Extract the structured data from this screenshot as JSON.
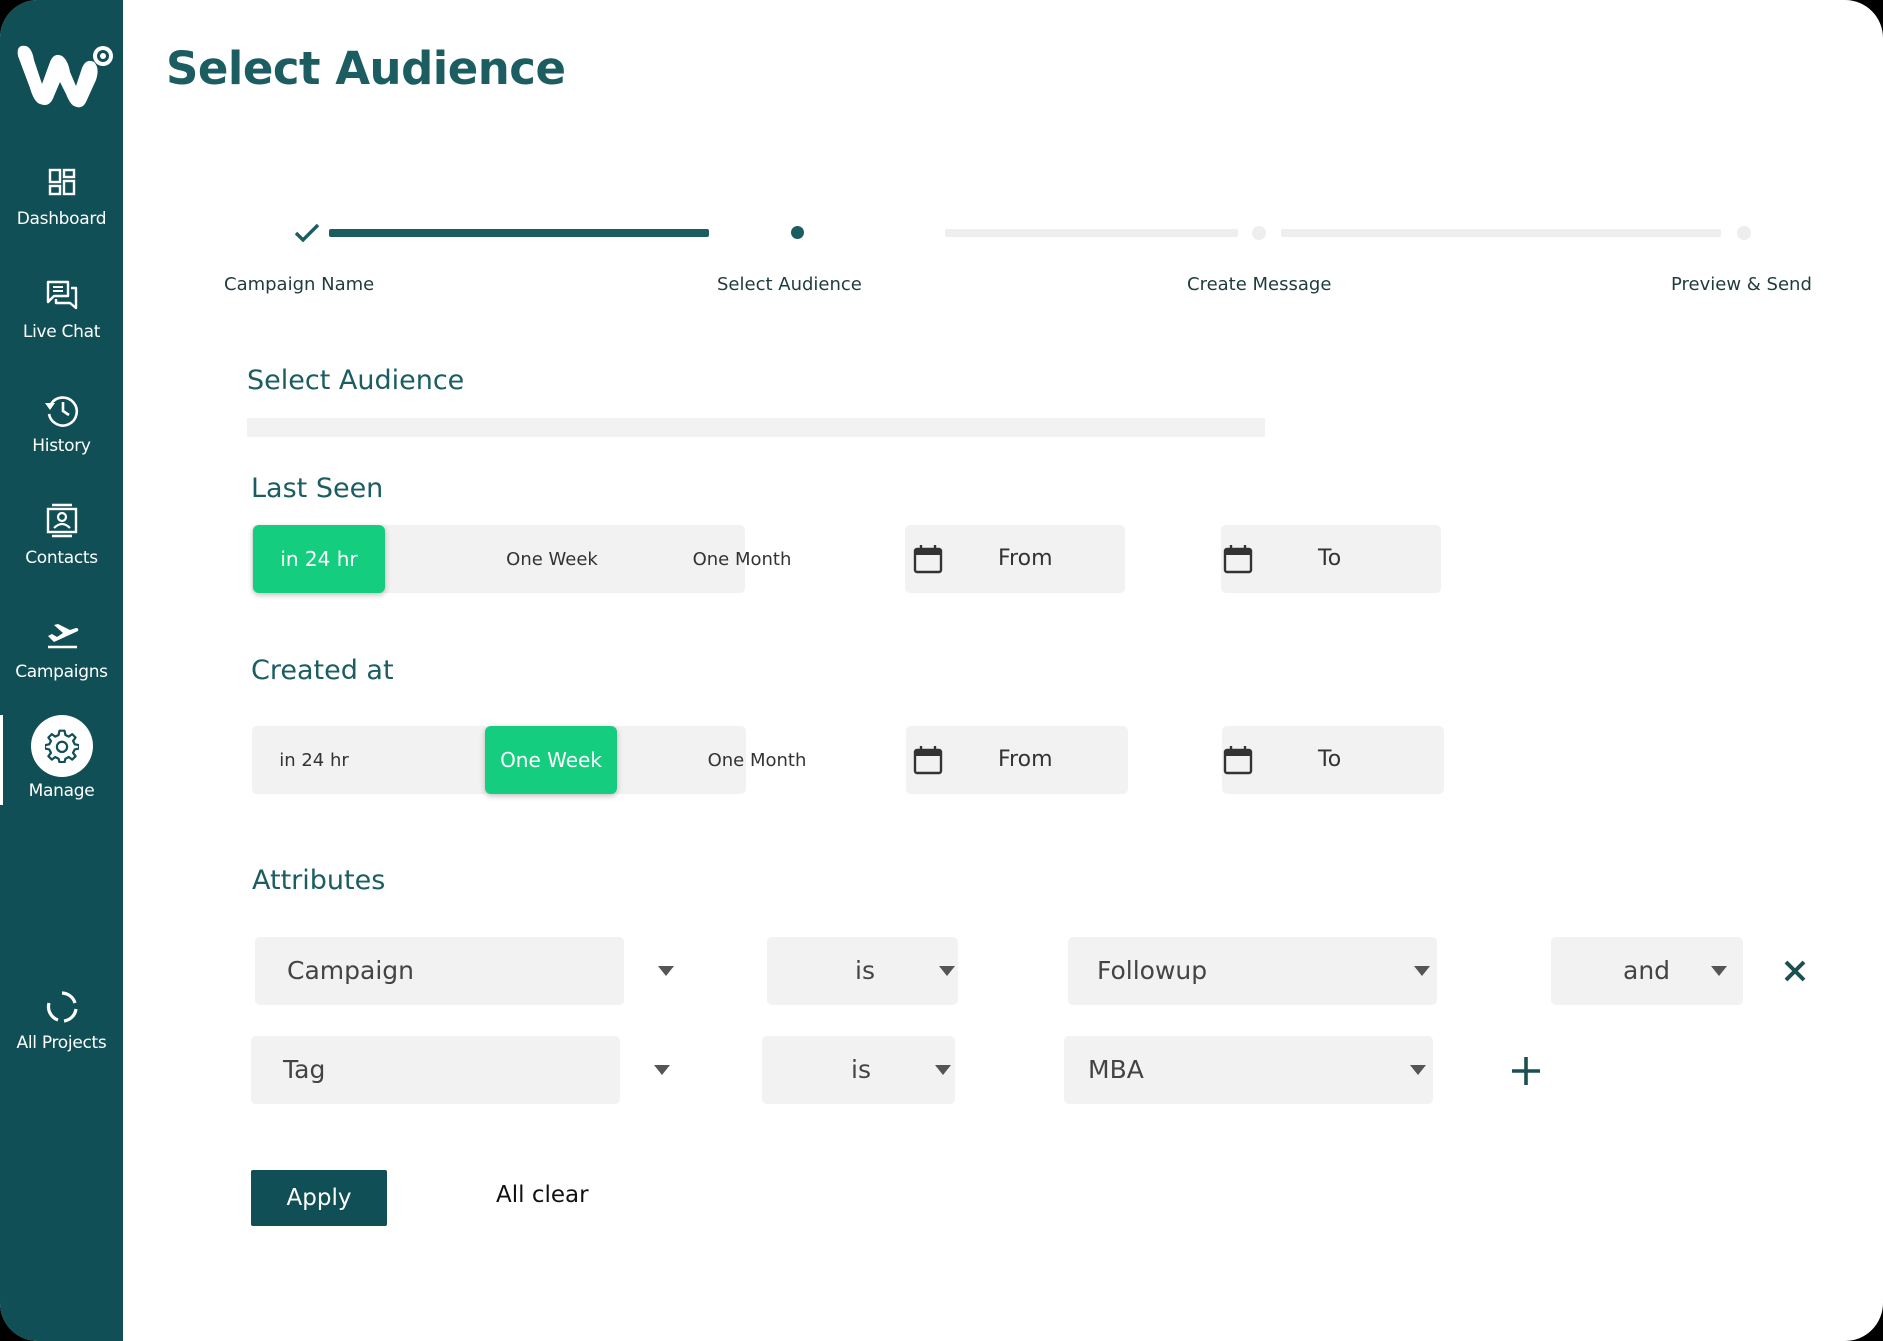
{
  "brand": {
    "primary": "#104f55",
    "accent": "#14cd7e",
    "logo_icon": "wati-logo-icon"
  },
  "page": {
    "title": "Select Audience"
  },
  "sidebar": {
    "items": [
      {
        "label": "Dashboard",
        "icon": "dashboard-icon"
      },
      {
        "label": "Live Chat",
        "icon": "chat-icon"
      },
      {
        "label": "History",
        "icon": "history-icon"
      },
      {
        "label": "Contacts",
        "icon": "contacts-icon"
      },
      {
        "label": "Campaigns",
        "icon": "plane-icon"
      },
      {
        "label": "Manage",
        "icon": "gear-icon",
        "active": true
      },
      {
        "label": "All Projects",
        "icon": "projects-icon"
      }
    ]
  },
  "stepper": {
    "steps": [
      {
        "label": "Campaign  Name",
        "status": "done"
      },
      {
        "label": "Select Audience",
        "status": "current"
      },
      {
        "label": "Create Message",
        "status": "upcoming"
      },
      {
        "label": "Preview & Send",
        "status": "upcoming"
      }
    ]
  },
  "audience": {
    "heading": "Select Audience",
    "last_seen": {
      "title": "Last Seen",
      "options": [
        "in 24 hr",
        "One Week",
        "One Month"
      ],
      "selected": "in 24 hr",
      "from": "From",
      "to": "To"
    },
    "created_at": {
      "title": "Created at",
      "options": [
        "in 24 hr",
        "One Week",
        "One Month"
      ],
      "selected": "One Week",
      "from": "From",
      "to": "To"
    },
    "attributes": {
      "title": "Attributes",
      "rows": [
        {
          "field": "Campaign",
          "operator": "is",
          "value": "Followup",
          "conjunction": "and"
        },
        {
          "field": "Tag",
          "operator": "is",
          "value": "MBA"
        }
      ]
    },
    "apply_label": "Apply",
    "clear_label": "All clear"
  }
}
